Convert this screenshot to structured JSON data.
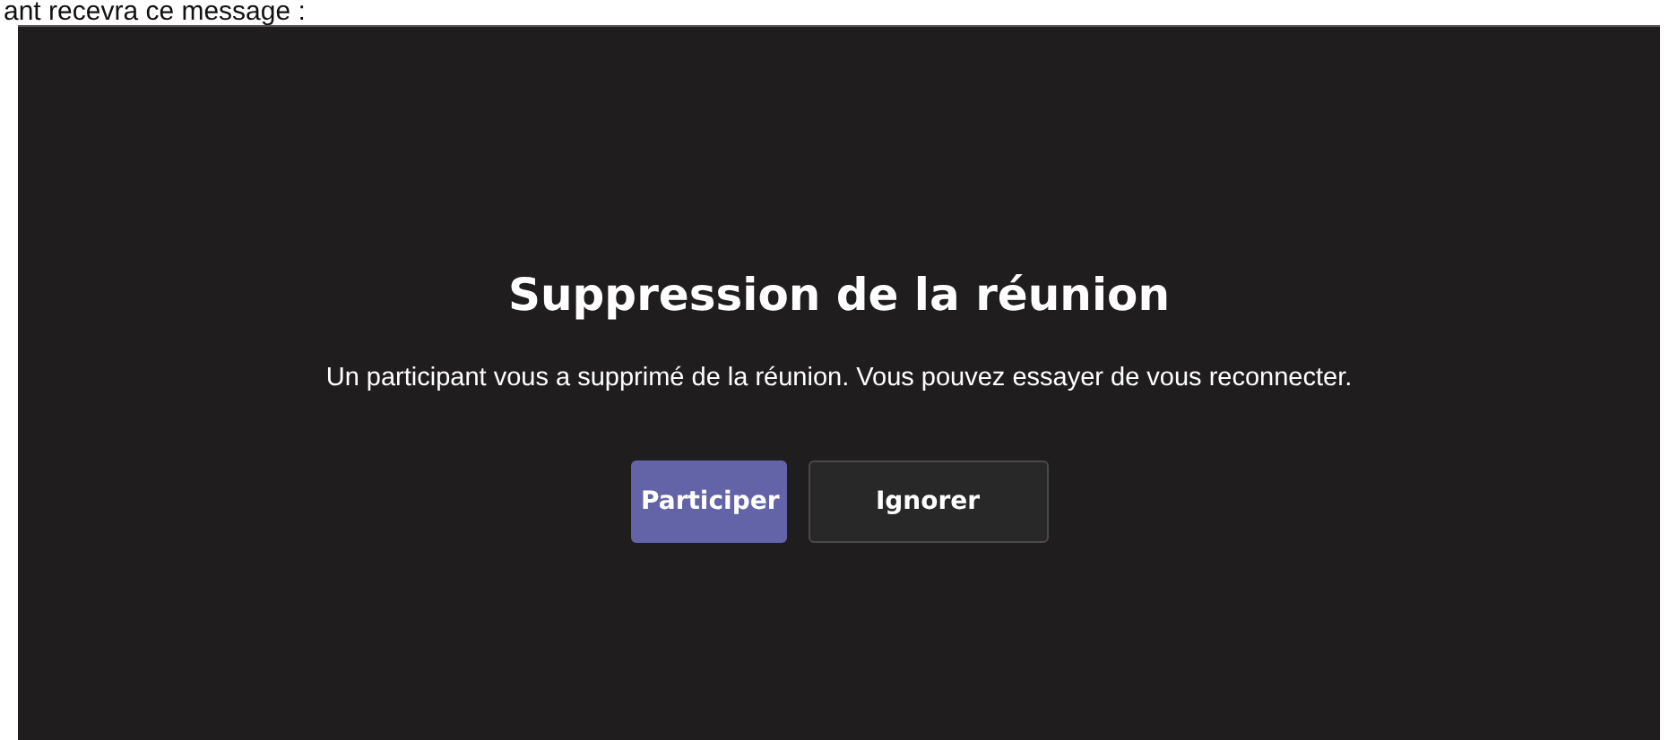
{
  "page_text": "ant recevra ce message :",
  "dialog": {
    "title": "Suppression de la réunion",
    "message": "Un participant vous a supprimé de la réunion. Vous pouvez essayer de vous reconnecter.",
    "buttons": [
      {
        "label": "Participer",
        "kind": "primary"
      },
      {
        "label": "Ignorer",
        "kind": "secondary"
      }
    ]
  }
}
